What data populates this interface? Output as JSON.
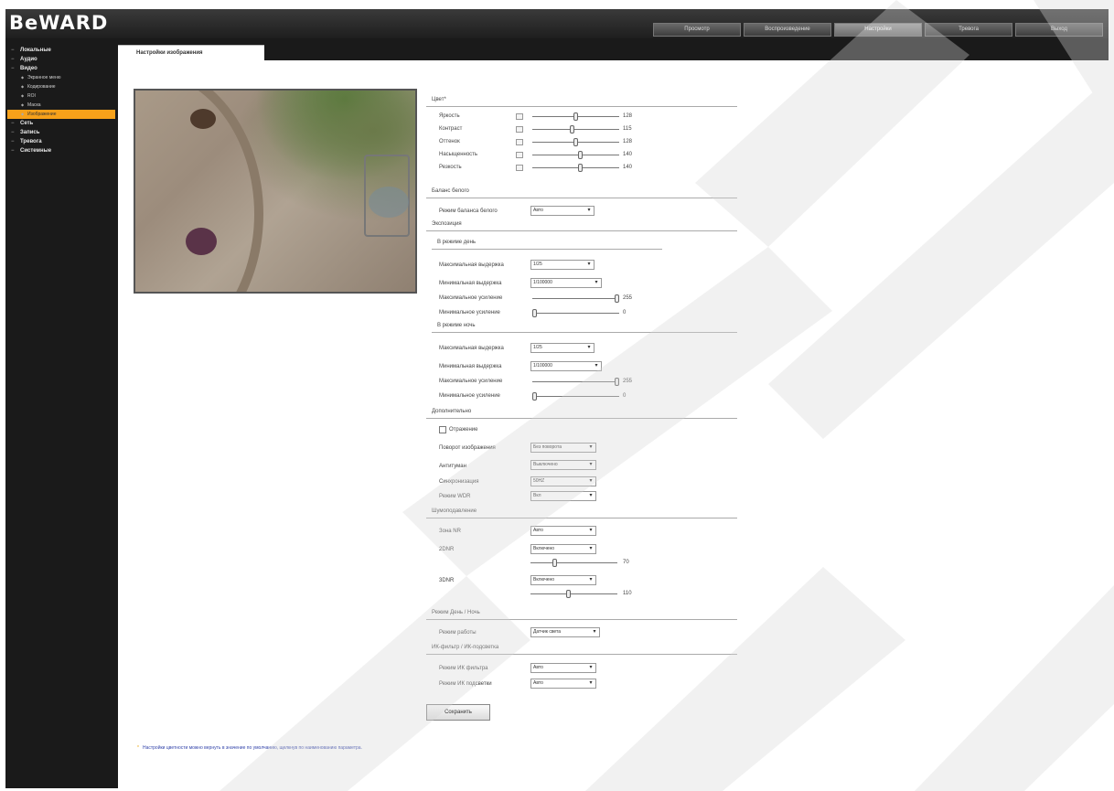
{
  "app": {
    "logo": "BeWARD"
  },
  "top_tabs": [
    {
      "label": "Просмотр"
    },
    {
      "label": "Воспроизведение"
    },
    {
      "label": "Настройки",
      "active": true
    },
    {
      "label": "Тревога"
    },
    {
      "label": "Выход"
    }
  ],
  "sidebar": {
    "items": [
      {
        "label": "Локальные"
      },
      {
        "label": "Аудио"
      },
      {
        "label": "Видео",
        "children": [
          {
            "label": "Экранное меню"
          },
          {
            "label": "Кодирование"
          },
          {
            "label": "ROI"
          },
          {
            "label": "Маска"
          },
          {
            "label": "Изображение",
            "active": true
          }
        ]
      },
      {
        "label": "Сеть"
      },
      {
        "label": "Запись"
      },
      {
        "label": "Тревога"
      },
      {
        "label": "Системные"
      }
    ]
  },
  "page_tab": "Настройки изображения",
  "form": {
    "color": {
      "title": "Цвет*",
      "rows": [
        {
          "label": "Яркость",
          "value": "128",
          "level": 0.5
        },
        {
          "label": "Контраст",
          "value": "115",
          "level": 0.45
        },
        {
          "label": "Оттенок",
          "value": "128",
          "level": 0.5
        },
        {
          "label": "Насыщенность",
          "value": "140",
          "level": 0.55
        },
        {
          "label": "Резкость",
          "value": "140",
          "level": 0.55
        }
      ]
    },
    "white_balance": {
      "title": "Баланс белого",
      "label": "Режим баланса белого",
      "value": "Авто"
    },
    "exposure": {
      "title": "Экспозиция",
      "day": {
        "title": "В режиме день",
        "max_shutter_label": "Максимальная выдержка",
        "max_shutter": "1/25",
        "min_shutter_label": "Минимальная выдержка",
        "min_shutter": "1/100000",
        "max_gain_label": "Максимальное усиление",
        "max_gain": "255",
        "max_gain_level": 1.0,
        "min_gain_label": "Минимальное усиление",
        "min_gain": "0",
        "min_gain_level": 0.0
      },
      "night": {
        "title": "В режиме ночь",
        "max_shutter_label": "Максимальная выдержка",
        "max_shutter": "1/25",
        "min_shutter_label": "Минимальная выдержка",
        "min_shutter": "1/100000",
        "max_gain_label": "Максимальное усиление",
        "max_gain": "255",
        "max_gain_level": 1.0,
        "min_gain_label": "Минимальное усиление",
        "min_gain": "0",
        "min_gain_level": 0.0
      }
    },
    "extra": {
      "title": "Дополнительно",
      "checkbox_label": "Отражение",
      "rows": [
        {
          "label": "Поворот изображения",
          "value": "Без поворота"
        },
        {
          "label": "Антитуман",
          "value": "Выключено"
        },
        {
          "label": "Синхронизация",
          "value": "50HZ"
        },
        {
          "label": "Режим WDR",
          "value": "Вкл"
        }
      ]
    },
    "day_night": {
      "title": "Шумоподавление",
      "rows": [
        {
          "label": "Зона NR",
          "value": "Авто"
        },
        {
          "label": "2DNR",
          "value": "Включено",
          "slider_value": "70",
          "level": 0.27
        },
        {
          "label": "3DNR",
          "value": "Включено",
          "slider_value": "110",
          "level": 0.43
        }
      ]
    },
    "mode": {
      "title": "Режим День / Ночь",
      "label": "Режим работы",
      "value": "Датчик света"
    },
    "ir": {
      "title": "ИК-фильтр / ИК-подсветка",
      "rows": [
        {
          "label": "Режим ИК фильтра",
          "value": "Авто"
        },
        {
          "label": "Режим ИК подсветки",
          "value": "Авто"
        }
      ]
    },
    "save_label": "Сохранить",
    "footnote": "Настройки цветности можно вернуть в значение по умолчанию, щелкнув по наименованию параметра."
  },
  "colors": {
    "accent": "#f7a11a",
    "dark": "#1a1a1a"
  }
}
